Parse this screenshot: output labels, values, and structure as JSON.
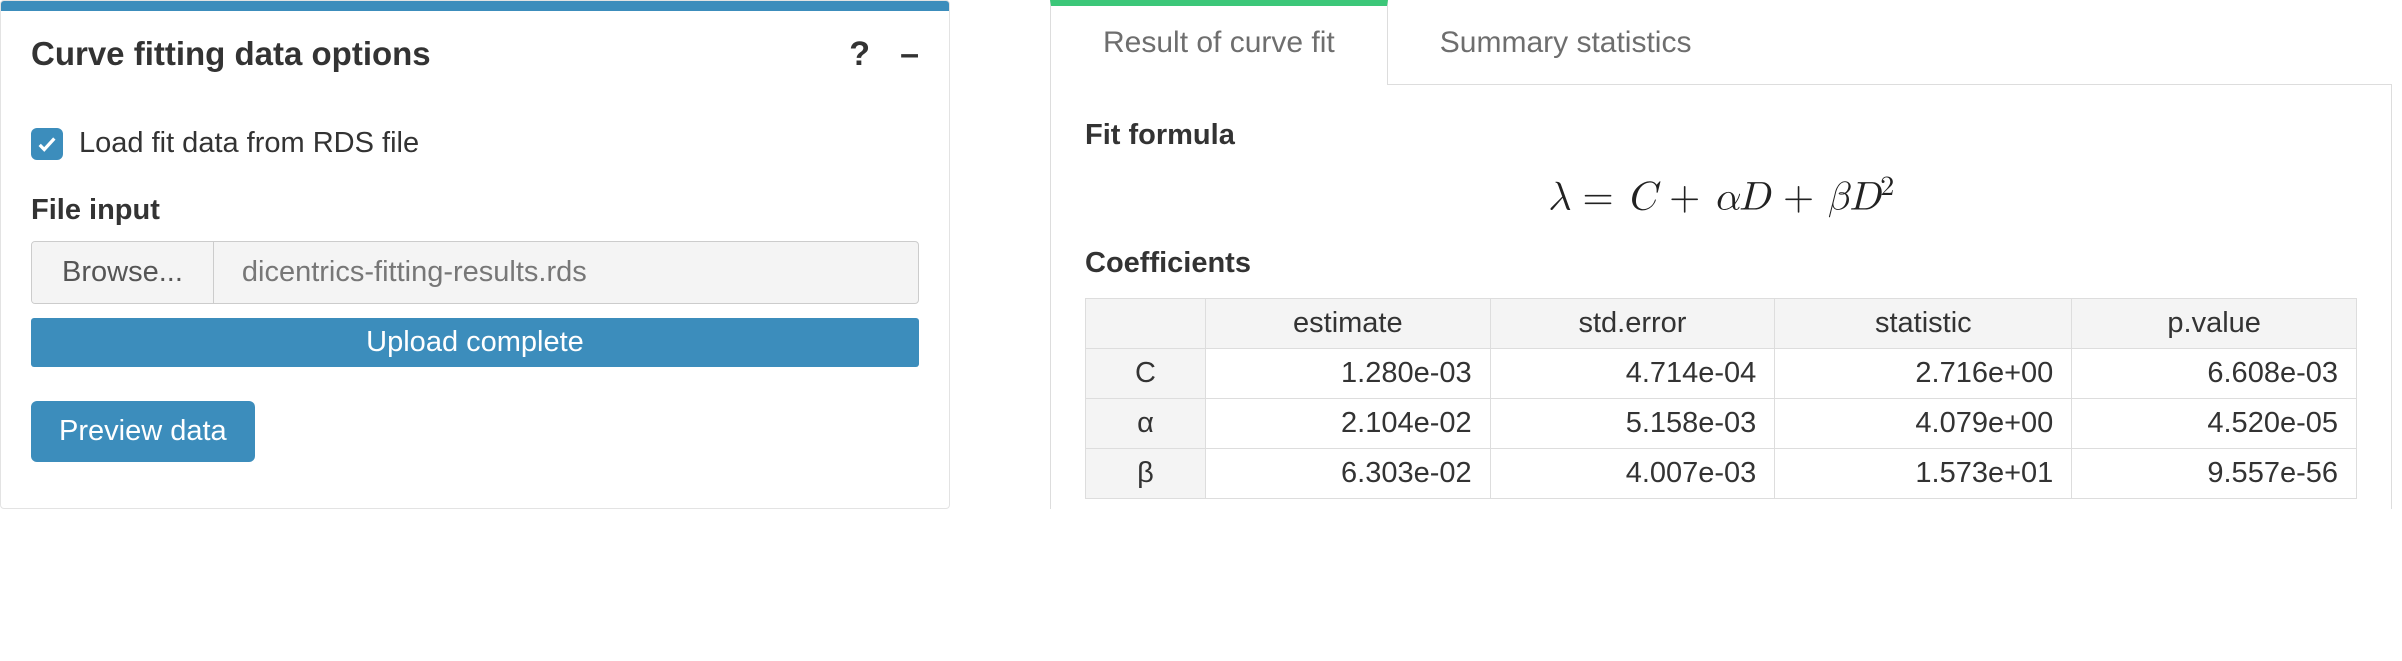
{
  "left": {
    "title": "Curve fitting data options",
    "checkbox_label": "Load fit data from RDS file",
    "file_input_label": "File input",
    "browse_label": "Browse...",
    "file_name": "dicentrics-fitting-results.rds",
    "upload_status": "Upload complete",
    "preview_label": "Preview data"
  },
  "right": {
    "tabs": [
      {
        "label": "Result of curve fit",
        "active": true
      },
      {
        "label": "Summary statistics",
        "active": false
      }
    ],
    "fit_formula_title": "Fit formula",
    "coefficients_title": "Coefficients",
    "table": {
      "headers": [
        "estimate",
        "std.error",
        "statistic",
        "p.value"
      ],
      "rows": [
        {
          "name": "C",
          "vals": [
            "1.280e-03",
            "4.714e-04",
            "2.716e+00",
            "6.608e-03"
          ]
        },
        {
          "name": "α",
          "vals": [
            "2.104e-02",
            "5.158e-03",
            "4.079e+00",
            "4.520e-05"
          ]
        },
        {
          "name": "β",
          "vals": [
            "6.303e-02",
            "4.007e-03",
            "1.573e+01",
            "9.557e-56"
          ]
        }
      ]
    }
  }
}
